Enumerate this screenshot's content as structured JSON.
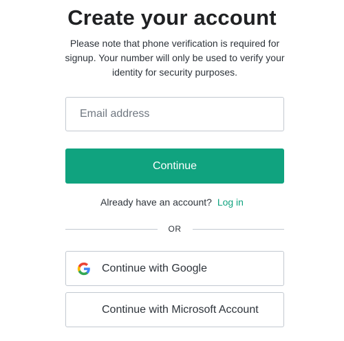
{
  "header": {
    "title": "Create your account",
    "subtitle": "Please note that phone verification is required for signup. Your number will only be used to verify your identity for security purposes."
  },
  "form": {
    "email_placeholder": "Email address",
    "email_value": "",
    "continue_label": "Continue"
  },
  "login": {
    "prompt": "Already have an account?",
    "link_label": "Log in"
  },
  "divider": {
    "label": "OR"
  },
  "social": {
    "google_label": "Continue with Google",
    "google_icon": "google-logo-icon",
    "microsoft_label": "Continue with Microsoft Account",
    "microsoft_icon": "microsoft-logo-icon"
  },
  "colors": {
    "accent": "#10a37f",
    "border": "#c2c8d0",
    "text": "#2d333a",
    "google_blue": "#4285f4",
    "google_red": "#ea4335",
    "google_yellow": "#fbbc05",
    "google_green": "#34a853",
    "ms_red": "#f25022",
    "ms_green": "#7fba00",
    "ms_blue": "#00a4ef",
    "ms_yellow": "#ffb900"
  }
}
